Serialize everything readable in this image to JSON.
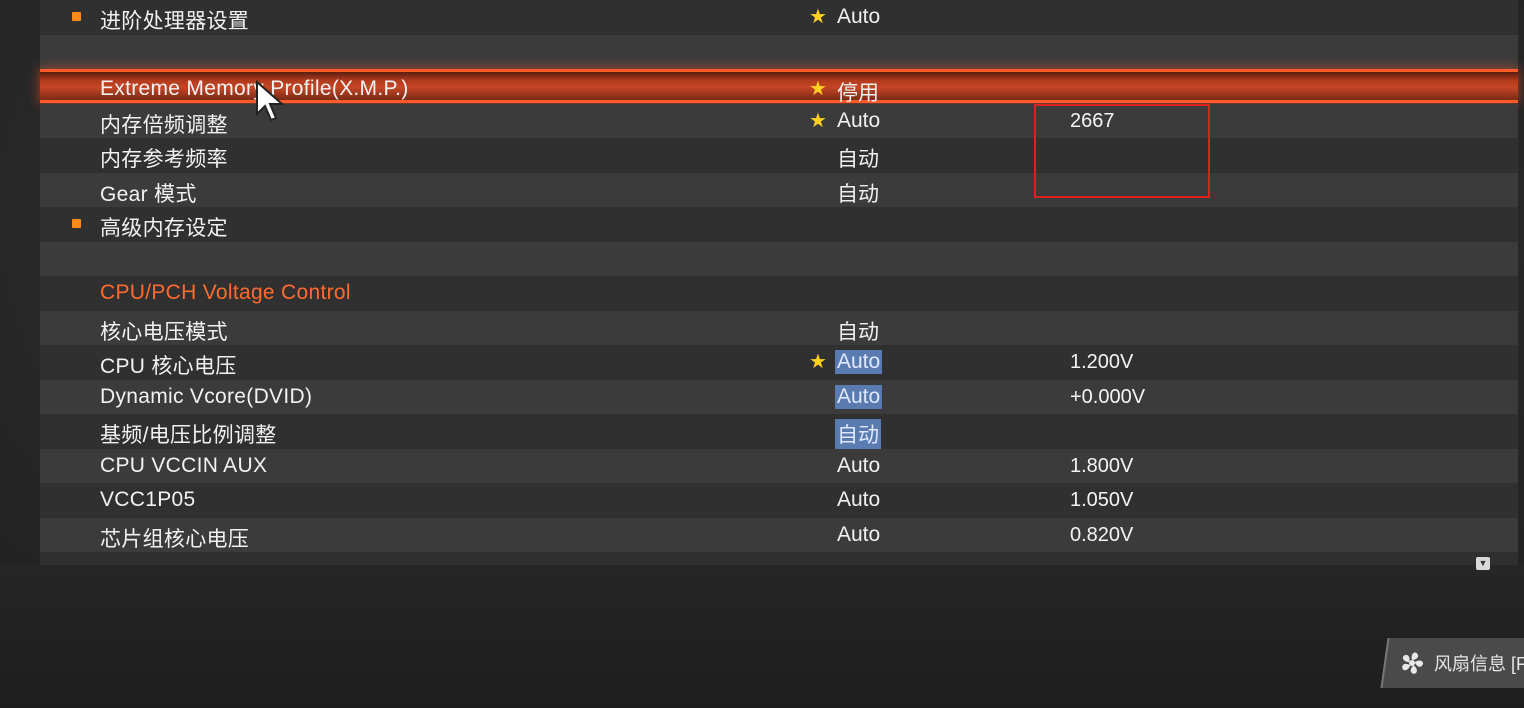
{
  "rows": [
    {
      "label": "进阶处理器设置",
      "bullet": true,
      "value": "Auto",
      "star": true
    },
    {
      "label": ""
    },
    {
      "label": "Extreme Memory Profile(X.M.P.)",
      "value": "停用",
      "star": true,
      "selected": true
    },
    {
      "label": "内存倍频调整",
      "value": "Auto",
      "star": true,
      "extra": "2667"
    },
    {
      "label": "内存参考频率",
      "value": "自动"
    },
    {
      "label": "Gear 模式",
      "value": "自动"
    },
    {
      "label": "高级内存设定",
      "bullet": true
    },
    {
      "label": ""
    },
    {
      "label": "CPU/PCH Voltage Control",
      "section": true
    },
    {
      "label": "核心电压模式",
      "value": "自动"
    },
    {
      "label": "CPU 核心电压",
      "value": "Auto",
      "star": true,
      "highlight": true,
      "extra": "1.200V"
    },
    {
      "label": "Dynamic Vcore(DVID)",
      "value": "Auto",
      "highlight": true,
      "extra": "+0.000V"
    },
    {
      "label": "基频/电压比例调整",
      "value": "自动",
      "highlight": true
    },
    {
      "label": "CPU VCCIN AUX",
      "value": "Auto",
      "extra": "1.800V"
    },
    {
      "label": "VCC1P05",
      "value": "Auto",
      "extra": "1.050V"
    },
    {
      "label": "芯片组核心电压",
      "value": "Auto",
      "extra": "0.820V"
    }
  ],
  "footer": {
    "fan_label": "风扇信息 [F",
    "fan_icon": "fan-icon",
    "scroll_icon": "scroll-down-icon"
  },
  "colors": {
    "accent": "#ff6a2e",
    "selection": "#c54624",
    "star": "#ffd21e",
    "bullet": "#ff8c1a",
    "highlight": "#5a7bb0",
    "annotation_box": "#e02020"
  }
}
